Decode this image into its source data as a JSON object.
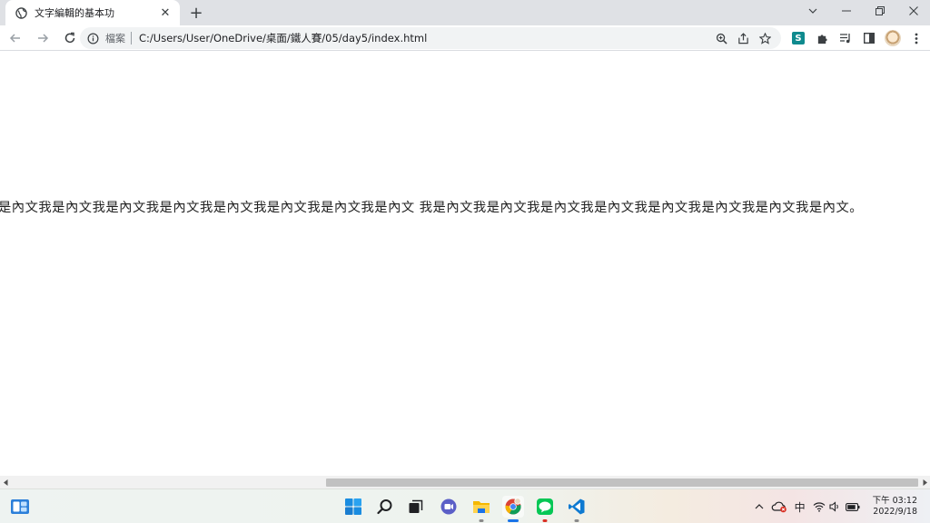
{
  "browser": {
    "tab": {
      "title": "文字編輯的基本功",
      "close_label": "✕"
    },
    "new_tab_label": "+",
    "window_controls": {
      "list_tabs": "⌄",
      "minimize": "—",
      "restore": "❐",
      "close": "✕"
    },
    "address_bar": {
      "scheme_label": "檔案",
      "url": "C:/Users/User/OneDrive/桌面/鐵人賽/05/day5/index.html"
    },
    "extension_badge": "S"
  },
  "page": {
    "body_text": "是內文我是內文我是內文我是內文我是內文我是內文我是內文我是內文 我是內文我是內文我是內文我是內文我是內文我是內文我是內文我是內文。"
  },
  "taskbar": {
    "tray": {
      "ime_label": "中",
      "time": "下午 03:12",
      "date": "2022/9/18"
    }
  },
  "colors": {
    "tab_strip": "#dfe1e5",
    "omnibox": "#f1f3f4",
    "scroll_thumb": "#c1c1c1",
    "chrome_active_dot": "#1a73e8"
  }
}
